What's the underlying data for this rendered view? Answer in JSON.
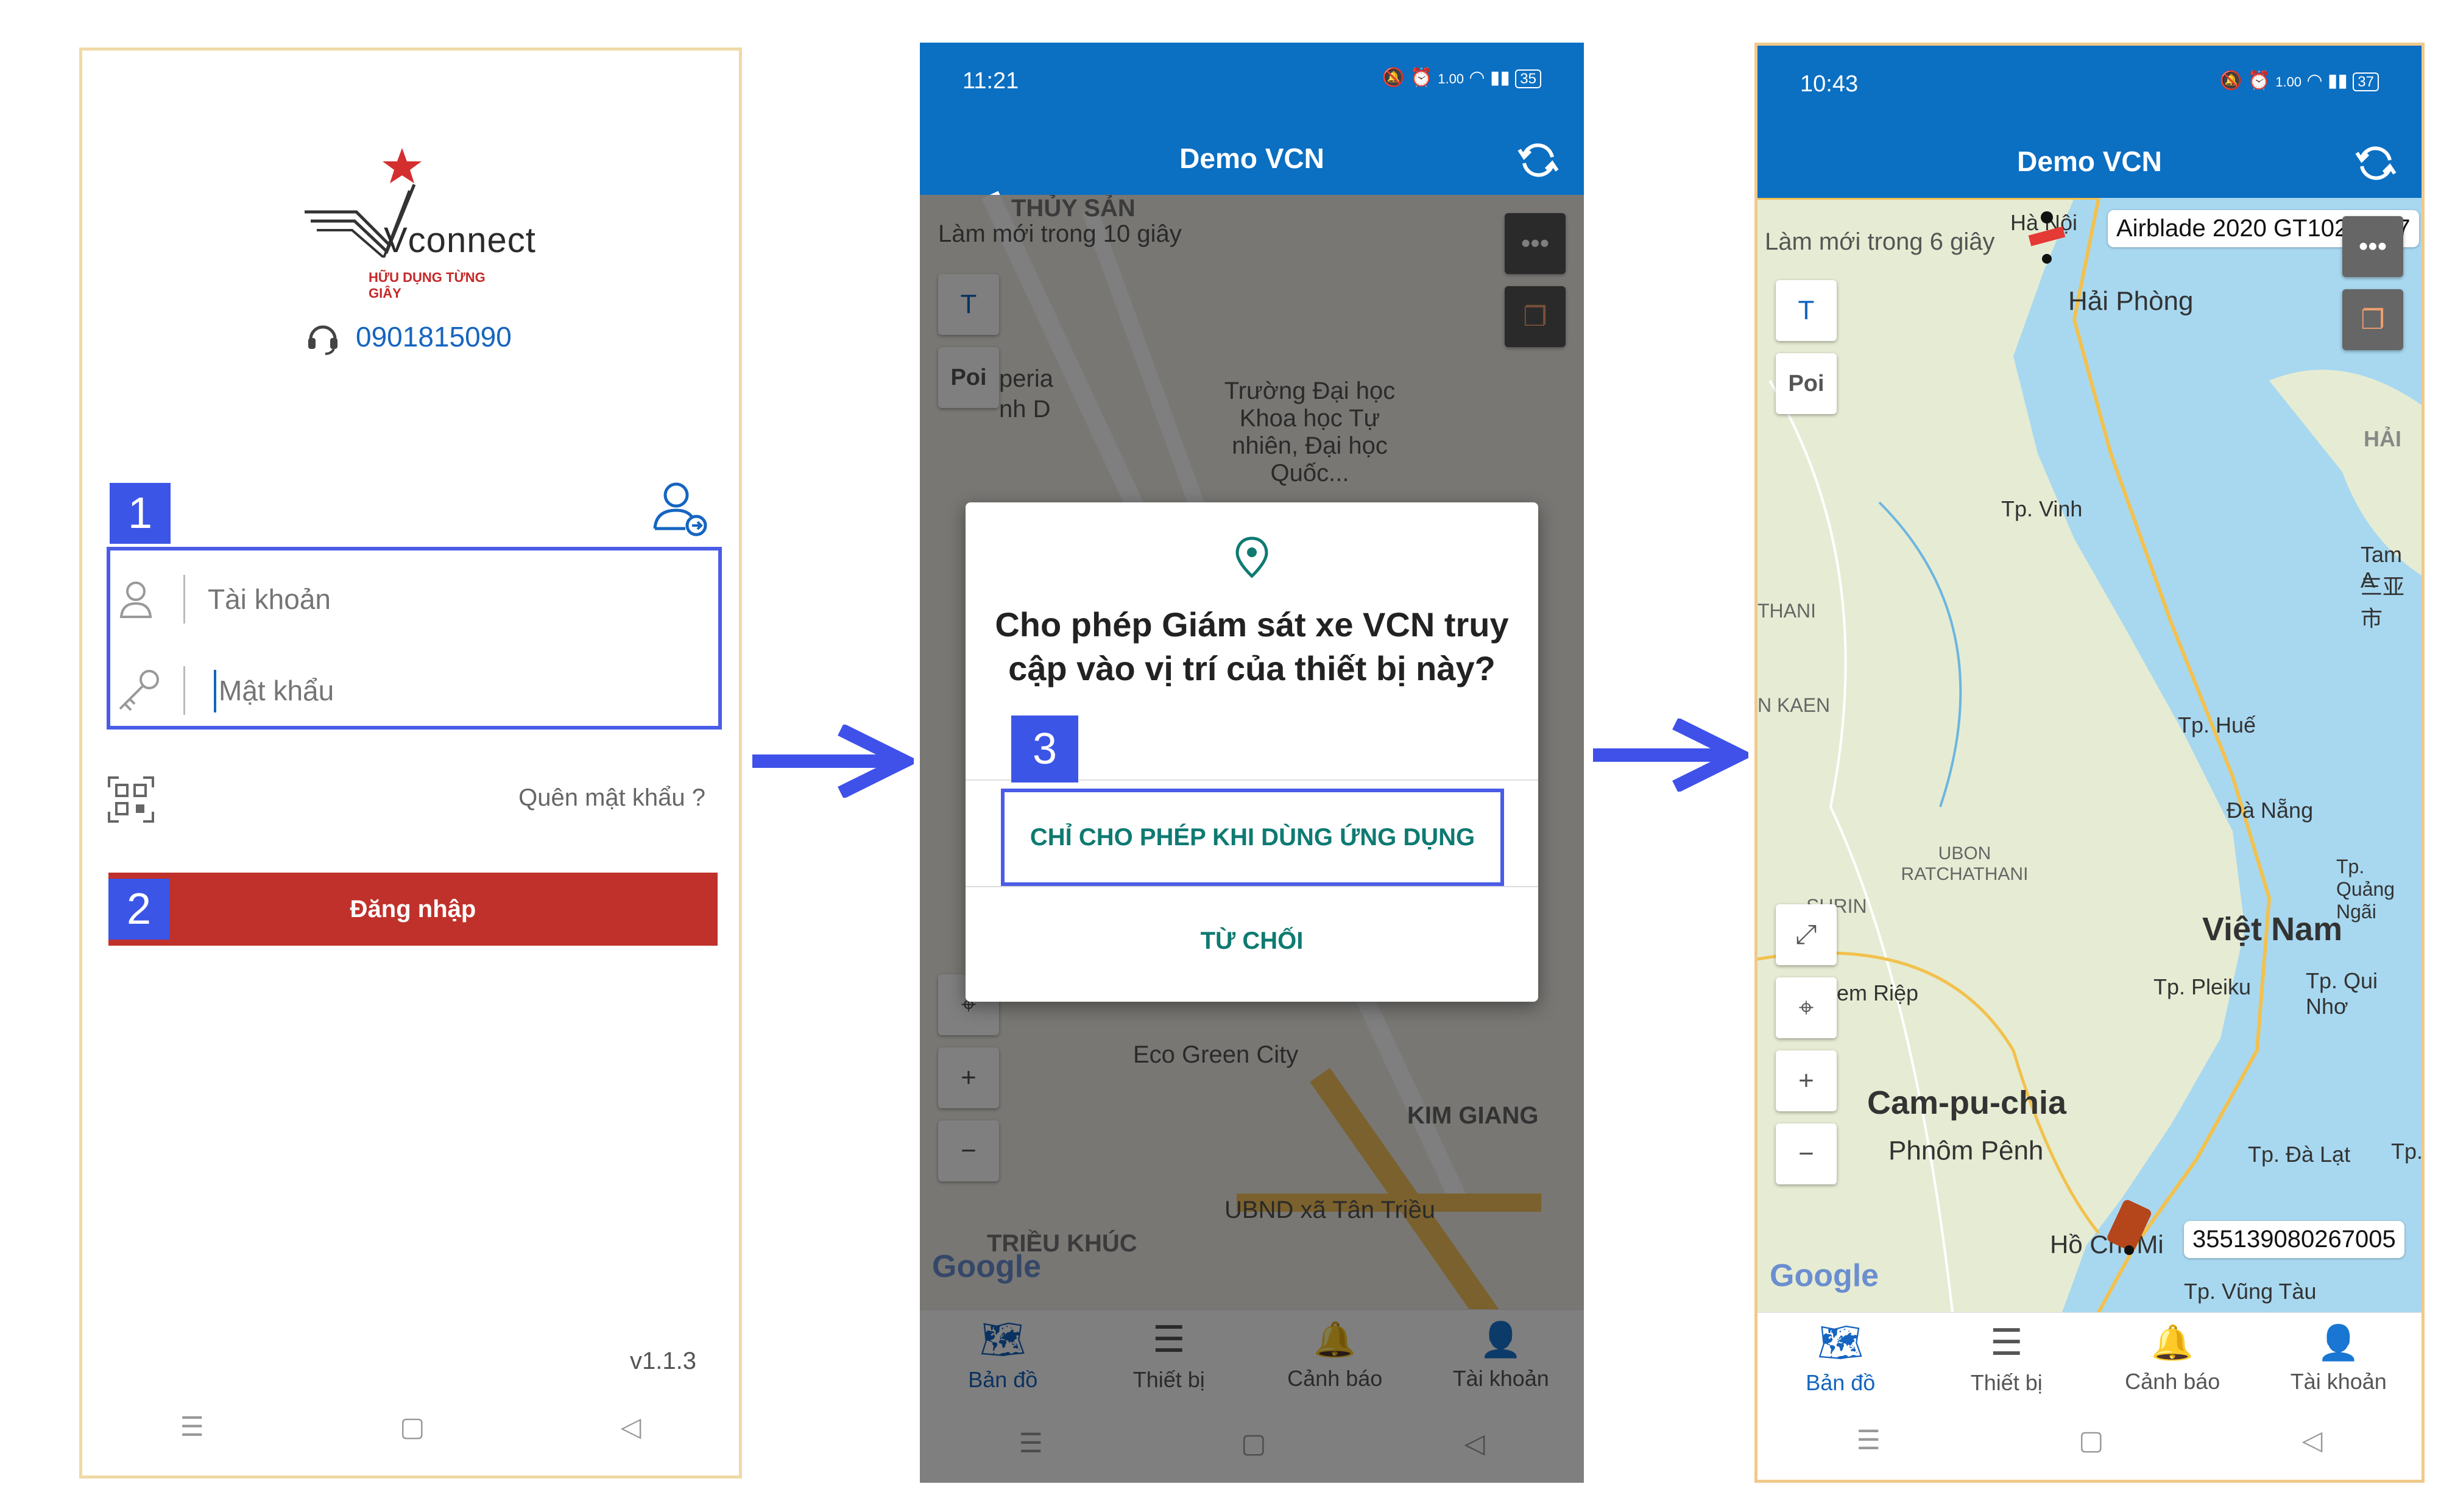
{
  "screen1": {
    "logo_text": "Vconnect",
    "logo_tagline": "HỮU DỤNG TỪNG GIÂY",
    "phone": "0901815090",
    "username_placeholder": "Tài khoản",
    "password_placeholder": "Mật khẩu",
    "forgot_password": "Quên mật khẩu ?",
    "login_button": "Đăng nhập",
    "version": "v1.1.3",
    "step1": "1",
    "step2": "2"
  },
  "screen2": {
    "time": "11:21",
    "net_speed": "1.00",
    "net_unit": "KB/S",
    "battery": "35",
    "title": "Demo VCN",
    "refresh_text": "Làm mới trong 10 giây",
    "map_labels": {
      "thuy_san": "THỦY SẢN",
      "truong_dai_hoc": "Trường Đại học Khoa học Tự nhiên, Đại học Quốc...",
      "eco_green": "Eco Green City",
      "kim_giang": "KIM GIANG",
      "ubnd": "UBND xã Tân Triều",
      "trieu_khuc": "TRIỀU KHÚC",
      "google": "Google",
      "imperia": "peria",
      "imperia2": "nh D"
    },
    "buttons": {
      "text_btn": "T",
      "poi_btn": "Poi"
    },
    "dialog": {
      "title": "Cho phép Giám sát xe VCN truy cập vào vị trí của thiết bị này?",
      "allow": "CHỈ CHO PHÉP KHI DÙNG ỨNG DỤNG",
      "deny": "TỪ CHỐI",
      "step3": "3"
    },
    "nav": [
      "Bản đồ",
      "Thiết bị",
      "Cảnh báo",
      "Tài khoản"
    ]
  },
  "screen3": {
    "time": "10:43",
    "net_speed": "1.00",
    "net_unit": "KB/S",
    "battery": "37",
    "title": "Demo VCN",
    "refresh_text": "Làm mới trong 6 giây",
    "vehicle1": "Airblade 2020 GT102-2327",
    "vehicle2": "355139080267005",
    "places": {
      "ha_noi": "Hà Nội",
      "hai_phong": "Hải Phòng",
      "vinh": "Tp. Vinh",
      "hai": "HẢI",
      "tam": "Tam A",
      "tam2": "三亚市",
      "thani": "THANI",
      "kaen": "N KAEN",
      "hue": "Tp. Huế",
      "da_nang": "Đà Nẵng",
      "ubon": "UBON RATCHATHANI",
      "quang_ngai": "Tp. Quảng Ngãi",
      "surin": "SURIN",
      "viet_nam": "Việt Nam",
      "siem_riep": "em Riệp",
      "pleiku": "Tp. Pleiku",
      "quy_nhon": "Tp. Qui Nhơ",
      "campuchia": "Cam-pu-chia",
      "phnom_penh": "Phnôm Pênh",
      "da_lat": "Tp. Đà Lạt",
      "tp": "Tp.",
      "hcm": "Hồ Chí Mi",
      "vung_tau": "Tp. Vũng Tàu",
      "google": "Google"
    },
    "buttons": {
      "text_btn": "T",
      "poi_btn": "Poi"
    },
    "nav": [
      "Bản đồ",
      "Thiết bị",
      "Cảnh báo",
      "Tài khoản"
    ]
  },
  "colors": {
    "brand_blue": "#0b6fc2",
    "login_red": "#c0312b",
    "step_blue": "#3b55e6",
    "arrow_blue": "#3f51e8"
  }
}
